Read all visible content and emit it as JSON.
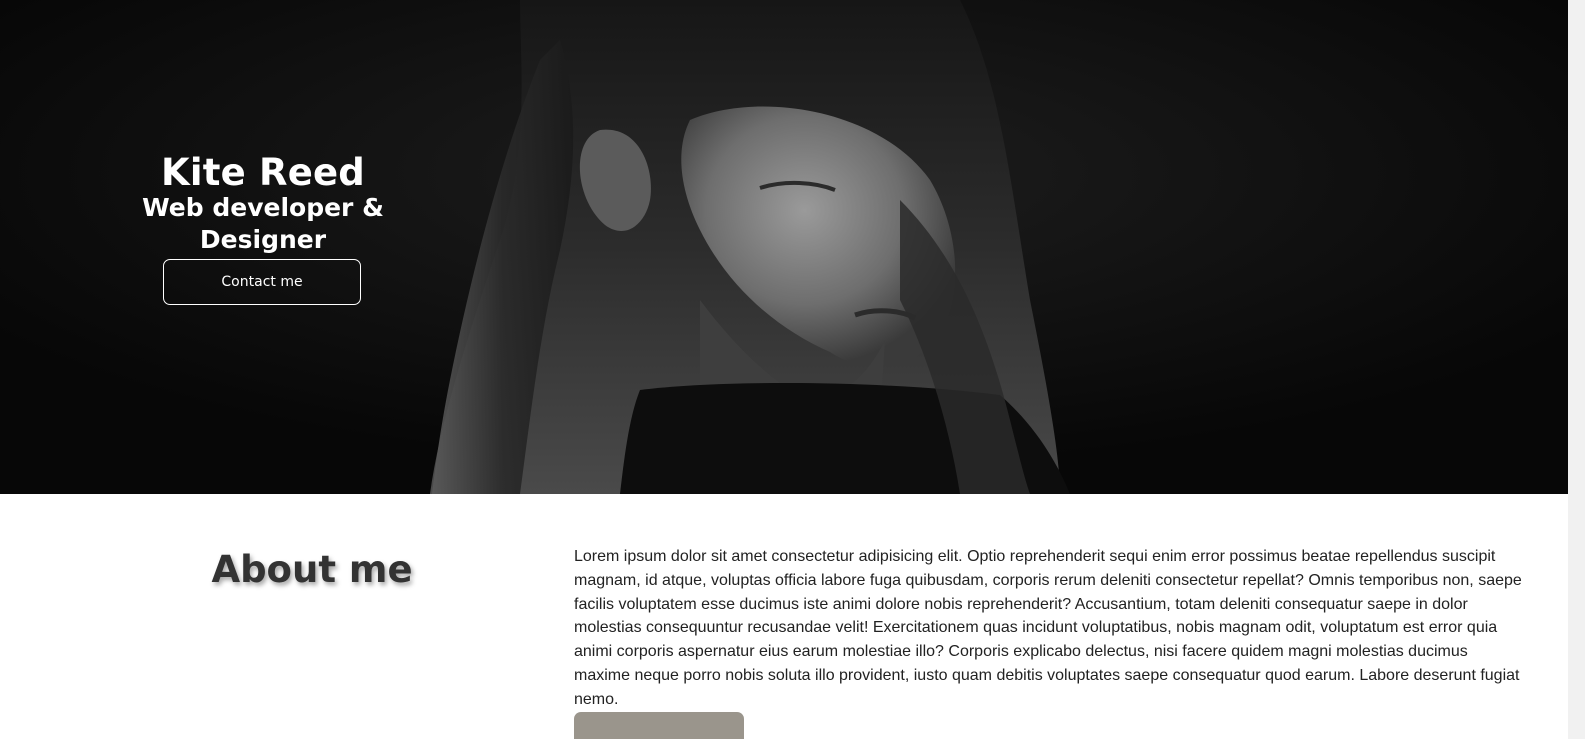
{
  "hero": {
    "name": "Kite Reed",
    "role": "Web developer & Designer",
    "contact_label": "Contact me",
    "photo_icon": "portrait-photo"
  },
  "about": {
    "heading": "About me",
    "body": "Lorem ipsum dolor sit amet consectetur adipisicing elit. Optio reprehenderit sequi enim error possimus beatae repellendus suscipit magnam, id atque, voluptas officia labore fuga quibusdam, corporis rerum deleniti consectetur repellat? Omnis temporibus non, saepe facilis voluptatem esse ducimus iste animi dolore nobis reprehenderit? Accusantium, totam deleniti consequatur saepe in dolor molestias consequuntur recusandae velit! Exercitationem quas incidunt voluptatibus, nobis magnam odit, voluptatum est error quia animi corporis aspernatur eius earum molestiae illo? Corporis explicabo delectus, nisi facere quidem magni molestias ducimus maxime neque porro nobis soluta illo provident, iusto quam debitis voluptates saepe consequatur quod earum. Labore deserunt fugiat nemo."
  },
  "colors": {
    "hero_bg": "#0b0b0b",
    "button_accent": "#9a958c",
    "text_dark": "#333333"
  }
}
